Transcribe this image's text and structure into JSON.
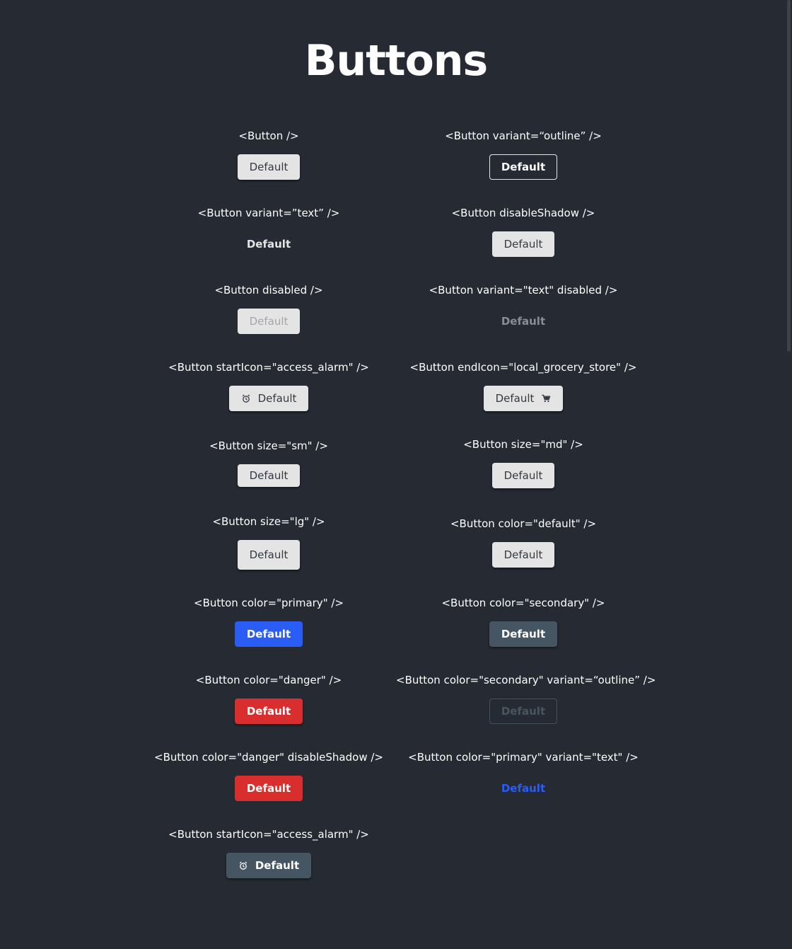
{
  "page": {
    "title": "Buttons"
  },
  "examples": {
    "basic": {
      "label": "<Button />",
      "button": "Default"
    },
    "outline": {
      "label": "<Button variant=“outline” />",
      "button": "Default"
    },
    "text": {
      "label": "<Button variant=”text” />",
      "button": "Default"
    },
    "disable_shadow": {
      "label": "<Button disableShadow />",
      "button": "Default"
    },
    "disabled": {
      "label": "<Button disabled />",
      "button": "Default"
    },
    "text_disabled": {
      "label": "<Button variant=\"text\" disabled />",
      "button": "Default"
    },
    "start_icon": {
      "label": "<Button startIcon=\"access_alarm\" />",
      "button": "Default",
      "icon": "alarm-icon"
    },
    "end_icon": {
      "label": "<Button endIcon=\"local_grocery_store\" />",
      "button": "Default",
      "icon": "cart-icon"
    },
    "size_sm": {
      "label": "<Button size=\"sm\" />",
      "button": "Default"
    },
    "size_md": {
      "label": "<Button size=\"md\" />",
      "button": "Default"
    },
    "size_lg": {
      "label": "<Button size=\"lg\" />",
      "button": "Default"
    },
    "color_default": {
      "label": "<Button color=\"default\" />",
      "button": "Default"
    },
    "color_primary": {
      "label": "<Button color=\"primary\" />",
      "button": "Default"
    },
    "color_secondary": {
      "label": "<Button color=\"secondary\" />",
      "button": "Default"
    },
    "color_danger": {
      "label": "<Button color=\"danger\" />",
      "button": "Default"
    },
    "secondary_outline": {
      "label": "<Button color=\"secondary\" variant=“outline” />",
      "button": "Default"
    },
    "danger_noshadow": {
      "label": "<Button color=\"danger\" disableShadow />",
      "button": "Default"
    },
    "primary_text": {
      "label": "<Button color=\"primary\" variant=\"text\" />",
      "button": "Default"
    },
    "secondary_icon": {
      "label": "<Button startIcon=\"access_alarm\" />",
      "button": "Default",
      "icon": "alarm-icon"
    }
  },
  "colors": {
    "background": "#262a33",
    "default": "#e4e4e4",
    "primary": "#2a5cf6",
    "secondary": "#465562",
    "danger": "#d92e2e"
  }
}
